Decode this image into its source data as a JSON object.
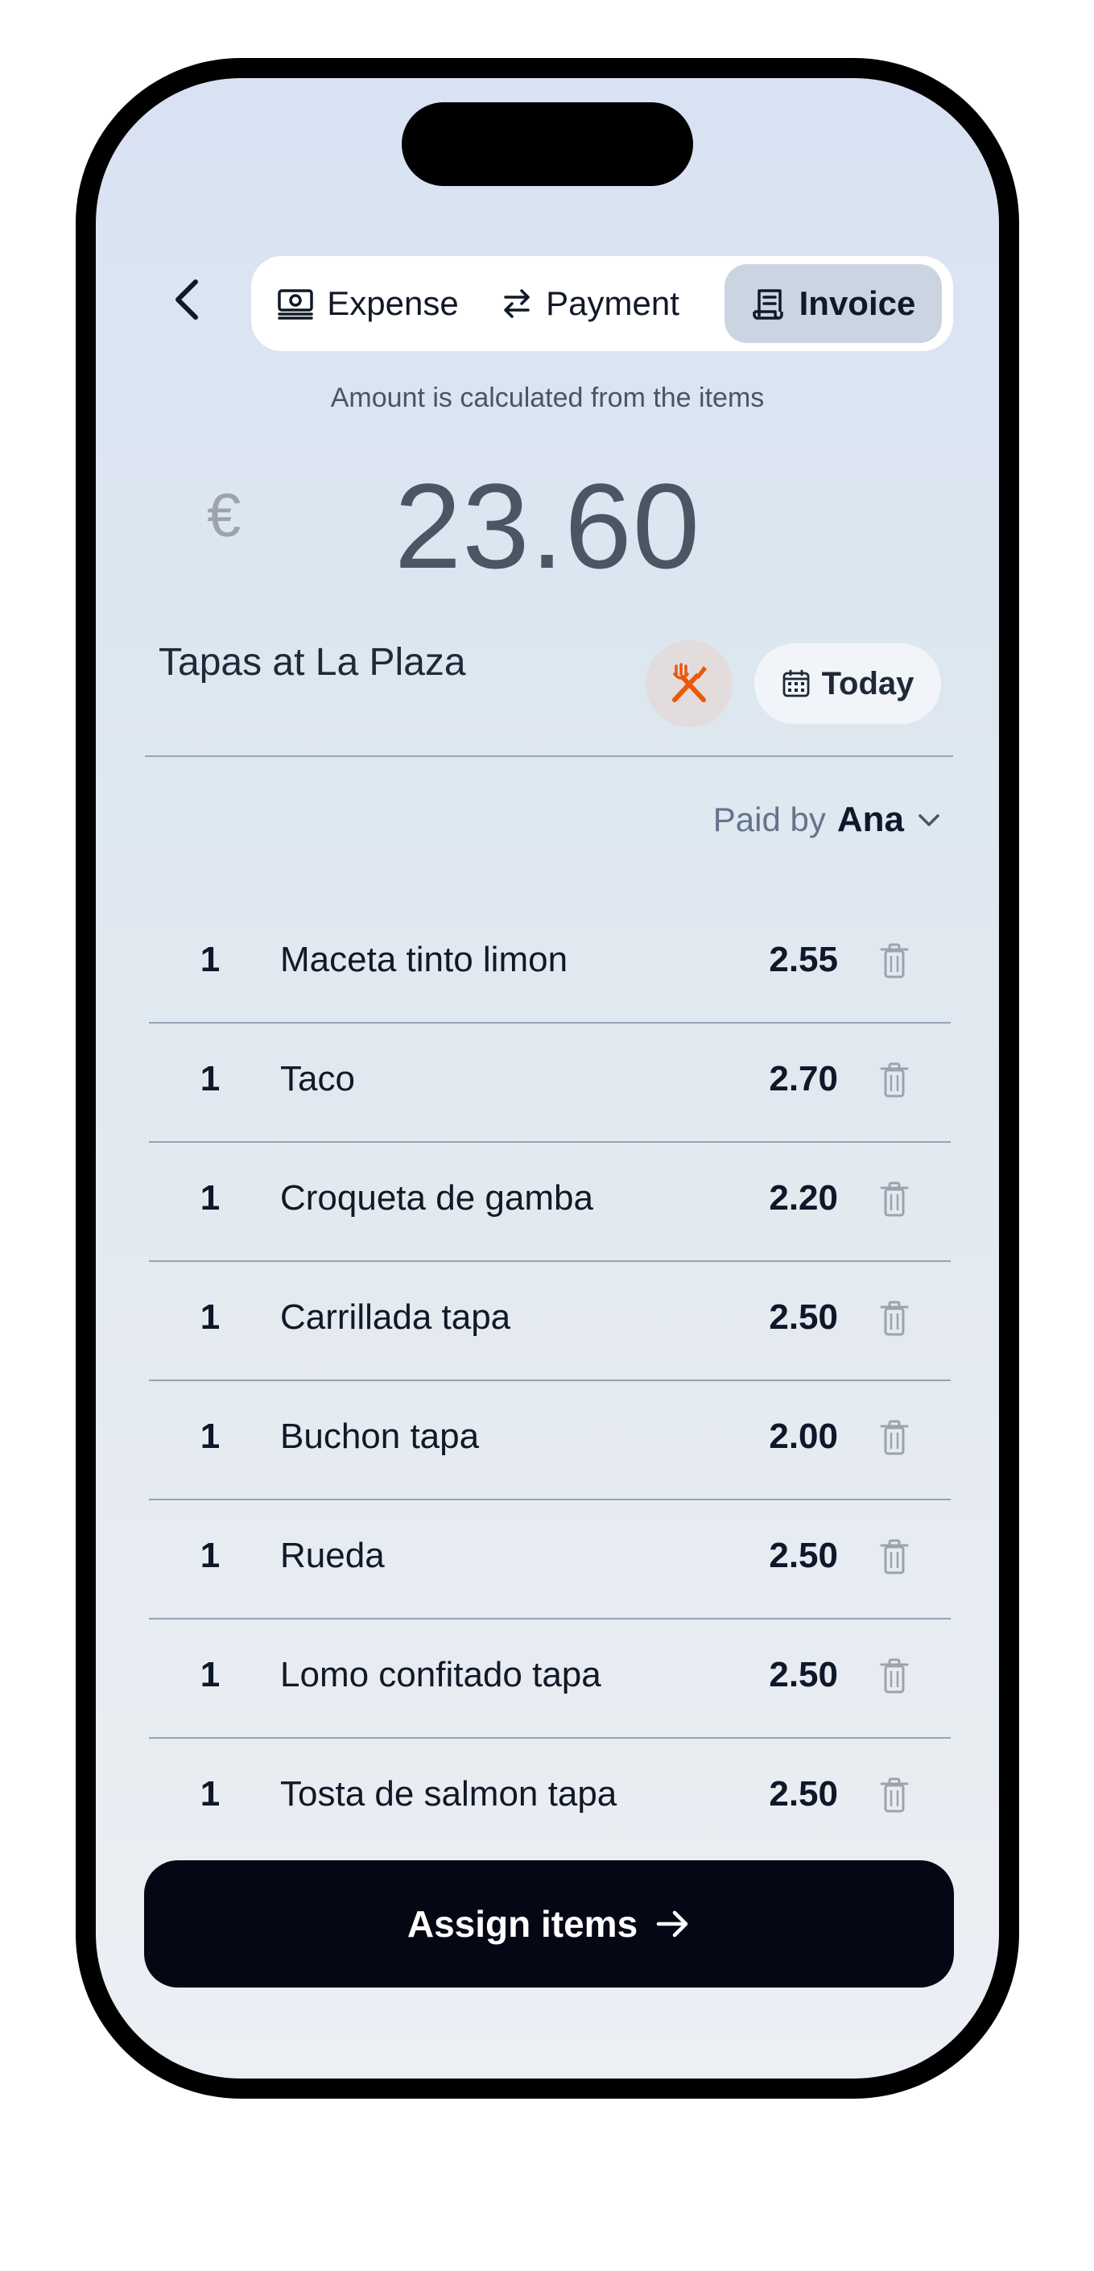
{
  "header": {
    "tabs": [
      {
        "label": "Expense",
        "icon": "banknote-icon",
        "active": false
      },
      {
        "label": "Payment",
        "icon": "swap-arrows-icon",
        "active": false
      },
      {
        "label": "Invoice",
        "icon": "receipt-icon",
        "active": true
      }
    ]
  },
  "amount": {
    "hint": "Amount is calculated from the items",
    "currency": "€",
    "value": "23.60"
  },
  "expense": {
    "title": "Tapas at La Plaza",
    "category_icon": "fork-knife-icon",
    "date_label": "Today"
  },
  "paid_by": {
    "label": "Paid by",
    "name": "Ana"
  },
  "items": [
    {
      "qty": "1",
      "name": "Maceta tinto limon",
      "price": "2.55"
    },
    {
      "qty": "1",
      "name": "Taco",
      "price": "2.70"
    },
    {
      "qty": "1",
      "name": "Croqueta de gamba",
      "price": "2.20"
    },
    {
      "qty": "1",
      "name": "Carrillada tapa",
      "price": "2.50"
    },
    {
      "qty": "1",
      "name": "Buchon tapa",
      "price": "2.00"
    },
    {
      "qty": "1",
      "name": "Rueda",
      "price": "2.50"
    },
    {
      "qty": "1",
      "name": "Lomo confitado tapa",
      "price": "2.50"
    },
    {
      "qty": "1",
      "name": "Tosta de salmon tapa",
      "price": "2.50"
    }
  ],
  "footer": {
    "assign_label": "Assign items"
  },
  "colors": {
    "accent_dark": "#050814",
    "category_orange": "#ea580c",
    "divider": "#94a3b8"
  }
}
